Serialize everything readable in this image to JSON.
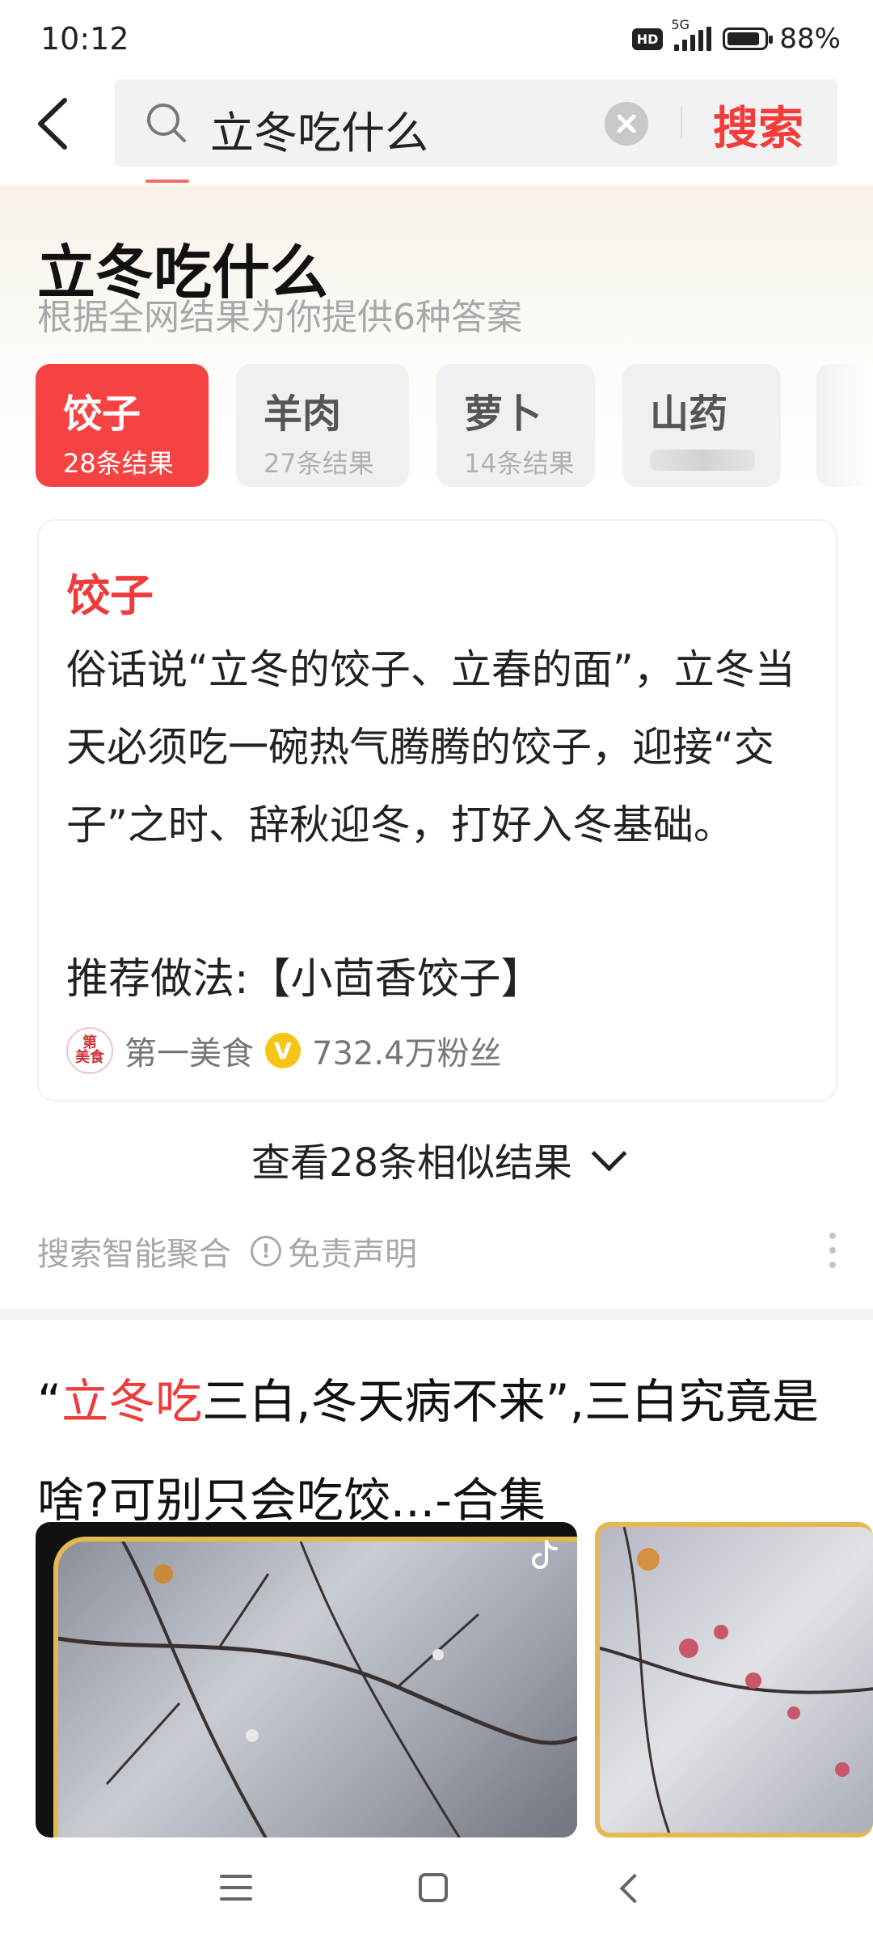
{
  "status": {
    "time": "10:12",
    "hd": "HD",
    "network": "5G",
    "battery": "88%",
    "battery_level": 0.88
  },
  "search": {
    "query": "立冬吃什么",
    "button": "搜索"
  },
  "answer": {
    "title": "立冬吃什么",
    "subtitle": "根据全网结果为你提供6种答案",
    "chips": [
      {
        "label": "饺子",
        "count": "28条结果"
      },
      {
        "label": "羊肉",
        "count": "27条结果"
      },
      {
        "label": "萝卜",
        "count": "14条结果"
      },
      {
        "label": "山药",
        "count": ""
      }
    ],
    "card": {
      "heading": "饺子",
      "body": "俗话说“立冬的饺子、立春的面”，立冬当天必须吃一碗热气腾腾的饺子，迎接“交子”之时、辞秋迎冬，打好入冬基础。",
      "recommend": "推荐做法:【小茴香饺子】",
      "author_logo": "第一美食",
      "author": "第一美食",
      "verified_badge": "V",
      "followers": "732.4万粉丝"
    },
    "more": "查看28条相似结果",
    "aggregate": "搜索智能聚合",
    "disclaimer": "免责声明"
  },
  "result": {
    "title_prefix": "“",
    "title_highlight": "立冬吃",
    "title_rest": "三白,冬天病不来”,三白究竟是啥?可别只会吃饺...-合集"
  },
  "colors": {
    "accent": "#f23c3c",
    "gold_border": "#e5b850"
  },
  "icons": [
    "back-arrow-icon",
    "search-icon",
    "clear-icon",
    "chevron-down-icon",
    "info-icon",
    "more-vertical-icon",
    "tiktok-icon",
    "menu-icon",
    "home-icon",
    "nav-back-icon"
  ]
}
